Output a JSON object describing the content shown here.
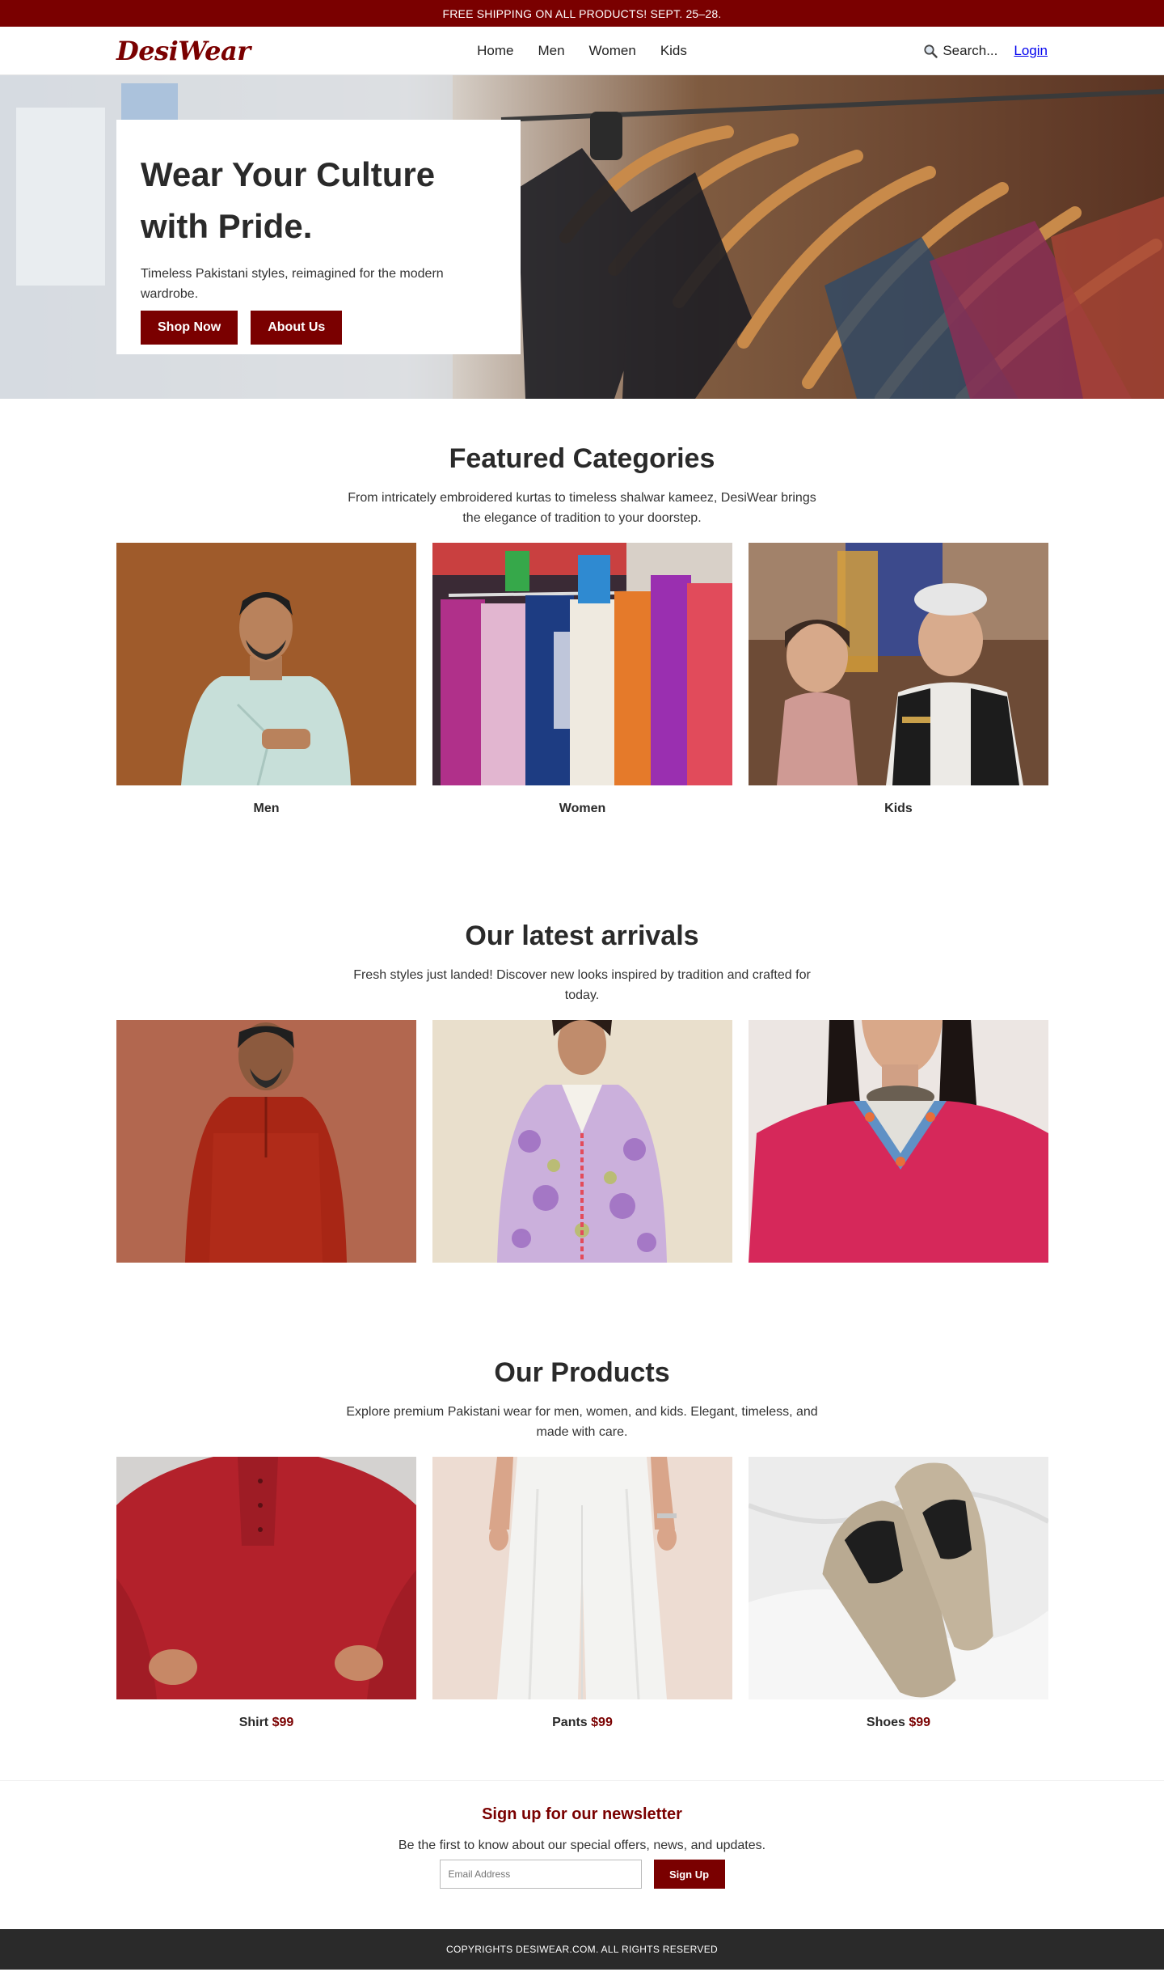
{
  "promo": {
    "text": "FREE SHIPPING ON ALL PRODUCTS! SEPT. 25–28."
  },
  "nav": {
    "logo": "DesiWear",
    "links": [
      "Home",
      "Men",
      "Women",
      "Kids"
    ],
    "search_label": "Search...",
    "login_label": "Login"
  },
  "hero": {
    "title_line1": "Wear Your Culture",
    "title_line2": "with Pride.",
    "subtitle": "Timeless Pakistani styles, reimagined for the modern wardrobe.",
    "primary_button": "Shop Now",
    "secondary_button": "About Us"
  },
  "categories": {
    "title": "Featured Categories",
    "description": "From intricately embroidered kurtas to timeless shalwar kameez, DesiWear brings the elegance of tradition to your doorstep.",
    "items": [
      {
        "label": "Men"
      },
      {
        "label": "Women"
      },
      {
        "label": "Kids"
      }
    ]
  },
  "arrivals": {
    "title": "Our latest arrivals",
    "description": "Fresh styles just landed! Discover new looks inspired by tradition and crafted for today."
  },
  "products": {
    "title": "Our Products",
    "description": "Explore premium Pakistani wear for men, women, and kids. Elegant, timeless, and made with care.",
    "items": [
      {
        "name": "Shirt",
        "price": "$99"
      },
      {
        "name": "Pants",
        "price": "$99"
      },
      {
        "name": "Shoes",
        "price": "$99"
      }
    ]
  },
  "newsletter": {
    "title": "Sign up for our newsletter",
    "text": "Be the first to know about our special offers, news, and updates.",
    "placeholder": "Email Address",
    "button": "Sign Up"
  },
  "footer": {
    "text": "COPYRIGHTS DESIWEAR.COM. ALL RIGHTS RESERVED"
  },
  "colors": {
    "brand": "#7a0000",
    "footer_bg": "#2a2a2a",
    "login_link": "#0000ee"
  },
  "icons": {
    "search": "magnifying-glass-icon"
  }
}
